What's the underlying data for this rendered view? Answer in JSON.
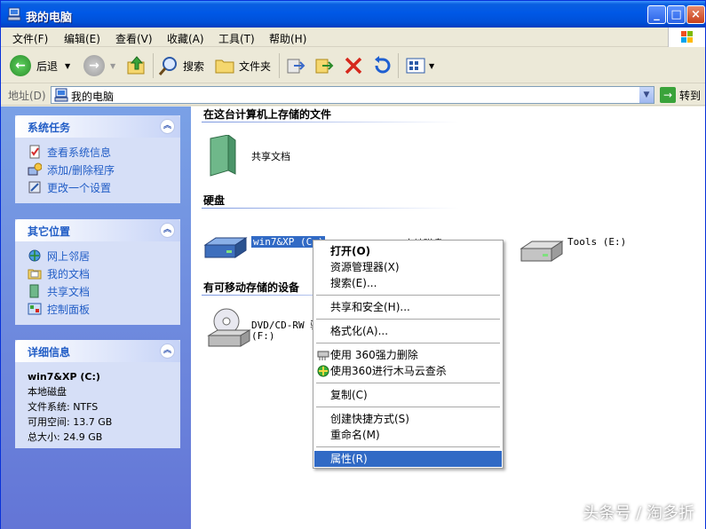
{
  "window": {
    "title": "我的电脑"
  },
  "menubar": [
    "文件(F)",
    "编辑(E)",
    "查看(V)",
    "收藏(A)",
    "工具(T)",
    "帮助(H)"
  ],
  "toolbar": {
    "back": "后退",
    "search": "搜索",
    "folders": "文件夹"
  },
  "address": {
    "label": "地址(D)",
    "value": "我的电脑",
    "go": "转到"
  },
  "system_tasks": {
    "title": "系统任务",
    "items": [
      "查看系统信息",
      "添加/删除程序",
      "更改一个设置"
    ]
  },
  "other_places": {
    "title": "其它位置",
    "items": [
      "网上邻居",
      "我的文档",
      "共享文档",
      "控制面板"
    ]
  },
  "details": {
    "title": "详细信息",
    "name": "win7&XP (C:)",
    "type": "本地磁盘",
    "fs": "文件系统: NTFS",
    "free": "可用空间: 13.7 GB",
    "total": "总大小: 24.9 GB"
  },
  "main": {
    "section_files": "在这台计算机上存储的文件",
    "shared_docs": "共享文档",
    "section_disks": "硬盘",
    "drive_c": "win7&XP (C:)",
    "drive_d": "本地磁盘 (D:)",
    "drive_e": "Tools (E:)",
    "section_removable": "有可移动存储的设备",
    "dvd_line1": "DVD/CD-RW 驱",
    "dvd_line2": "(F:)"
  },
  "context_menu": [
    "打开(O)",
    "资源管理器(X)",
    "搜索(E)...",
    "共享和安全(H)...",
    "格式化(A)...",
    "使用 360强力删除",
    "使用360进行木马云查杀",
    "复制(C)",
    "创建快捷方式(S)",
    "重命名(M)",
    "属性(R)"
  ],
  "watermark": "头条号 / 淘多折"
}
